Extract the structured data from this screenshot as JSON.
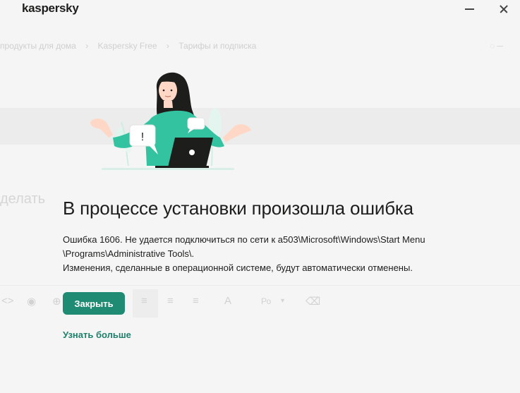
{
  "window": {
    "brand": "kaspersky",
    "minimize_icon": "minimize-icon",
    "close_icon": "close-icon"
  },
  "background_page": {
    "breadcrumbs": [
      "продукты для дома",
      "Kaspersky Free",
      "Тарифы и подписка"
    ],
    "heading_fragment": "делать",
    "toolbar_font_select": "Ро"
  },
  "dialog": {
    "title": "В процессе установки произошла ошибка",
    "message_line1": "Ошибка 1606. Не удается подключиться по сети к a503\\Microsoft\\Windows\\Start Menu",
    "message_line2": "\\Programs\\Administrative Tools\\.",
    "message_line3": "Изменения, сделанные в операционной системе, будут автоматически отменены.",
    "close_button": "Закрыть",
    "learn_more_link": "Узнать больше"
  },
  "colors": {
    "accent": "#1f8b72",
    "link": "#1e7f6a",
    "illustration_shirt": "#34c3a0",
    "background": "#f5f5f5"
  }
}
